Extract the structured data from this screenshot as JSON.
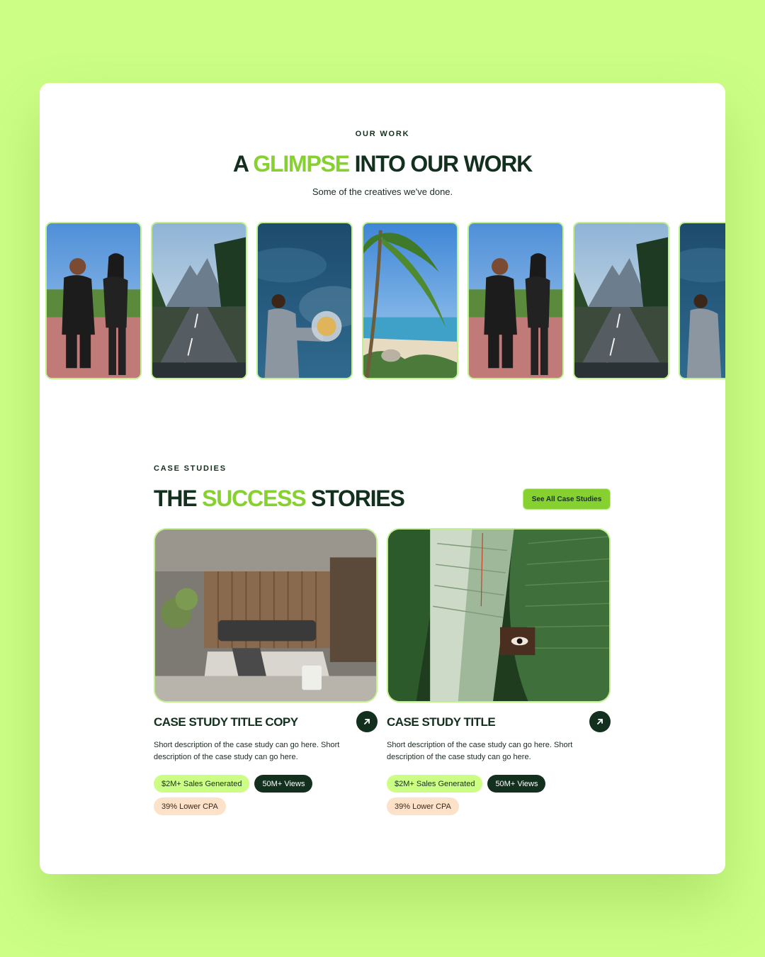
{
  "our_work": {
    "eyebrow": "OUR WORK",
    "heading": {
      "before": "A ",
      "highlight": "GLIMPSE",
      "after": " INTO OUR WORK"
    },
    "subtitle": "Some of the creatives we've done."
  },
  "gallery": {
    "tiles": [
      {
        "scene": "dancing-couple"
      },
      {
        "scene": "mountain-road"
      },
      {
        "scene": "astronaut-helmet"
      },
      {
        "scene": "palm-beach"
      },
      {
        "scene": "dancing-couple"
      },
      {
        "scene": "mountain-road"
      },
      {
        "scene": "astronaut-helmet"
      }
    ]
  },
  "case_studies": {
    "eyebrow": "CASE STUDIES",
    "heading": {
      "before": "THE ",
      "highlight": "SUCCESS",
      "after": " STORIES"
    },
    "see_all_label": "See All Case Studies",
    "items": [
      {
        "title": "CASE STUDY TITLE COPY",
        "description": "Short description of the case study can go here. Short description of the case study can go here.",
        "image": "bedroom-interior",
        "tags": [
          "$2M+ Sales Generated",
          "50M+ Views",
          "39% Lower CPA"
        ]
      },
      {
        "title": "CASE STUDY TITLE",
        "description": "Short description of the case study can go here. Short description of the case study can go here.",
        "image": "banana-leaf-face",
        "tags": [
          "$2M+ Sales Generated",
          "50M+ Views",
          "39% Lower CPA"
        ]
      }
    ]
  },
  "colors": {
    "background": "#ccfe85",
    "accent": "#86d12f",
    "dark": "#13301f",
    "peach": "#fde1c8"
  },
  "icons": {
    "card_link": "arrow-up-right-icon"
  }
}
